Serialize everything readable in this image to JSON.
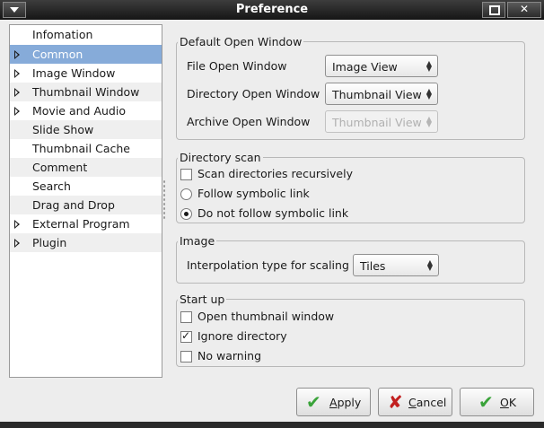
{
  "window": {
    "title": "Preference"
  },
  "sidebar": {
    "items": [
      {
        "label": "Infomation",
        "expandable": false
      },
      {
        "label": "Common",
        "expandable": true,
        "selected": true
      },
      {
        "label": "Image Window",
        "expandable": true
      },
      {
        "label": "Thumbnail Window",
        "expandable": true
      },
      {
        "label": "Movie and Audio",
        "expandable": true
      },
      {
        "label": "Slide Show",
        "expandable": false
      },
      {
        "label": "Thumbnail Cache",
        "expandable": false
      },
      {
        "label": "Comment",
        "expandable": false
      },
      {
        "label": "Search",
        "expandable": false
      },
      {
        "label": "Drag and Drop",
        "expandable": false
      },
      {
        "label": "External Program",
        "expandable": true
      },
      {
        "label": "Plugin",
        "expandable": true
      }
    ]
  },
  "default_open_window": {
    "legend": "Default Open Window",
    "file_label": "File Open Window",
    "file_value": "Image View",
    "directory_label": "Directory Open Window",
    "directory_value": "Thumbnail View",
    "archive_label": "Archive Open Window",
    "archive_value": "Thumbnail View"
  },
  "directory_scan": {
    "legend": "Directory scan",
    "recursive_label": "Scan directories recursively",
    "recursive_checked": false,
    "follow_label": "Follow symbolic link",
    "nofollow_label": "Do not follow symbolic link",
    "selected": "nofollow"
  },
  "image": {
    "legend": "Image",
    "interp_label": "Interpolation type for scaling",
    "interp_value": "Tiles"
  },
  "startup": {
    "legend": "Start up",
    "open_thumb_label": "Open thumbnail window",
    "open_thumb_checked": false,
    "ignore_dir_label": "Ignore directory",
    "ignore_dir_checked": true,
    "no_warning_label": "No warning",
    "no_warning_checked": false
  },
  "buttons": {
    "apply": "Apply",
    "cancel": "Cancel",
    "ok": "OK"
  },
  "icons": {
    "apply": "check-icon",
    "cancel": "x-icon",
    "ok": "check-icon"
  }
}
